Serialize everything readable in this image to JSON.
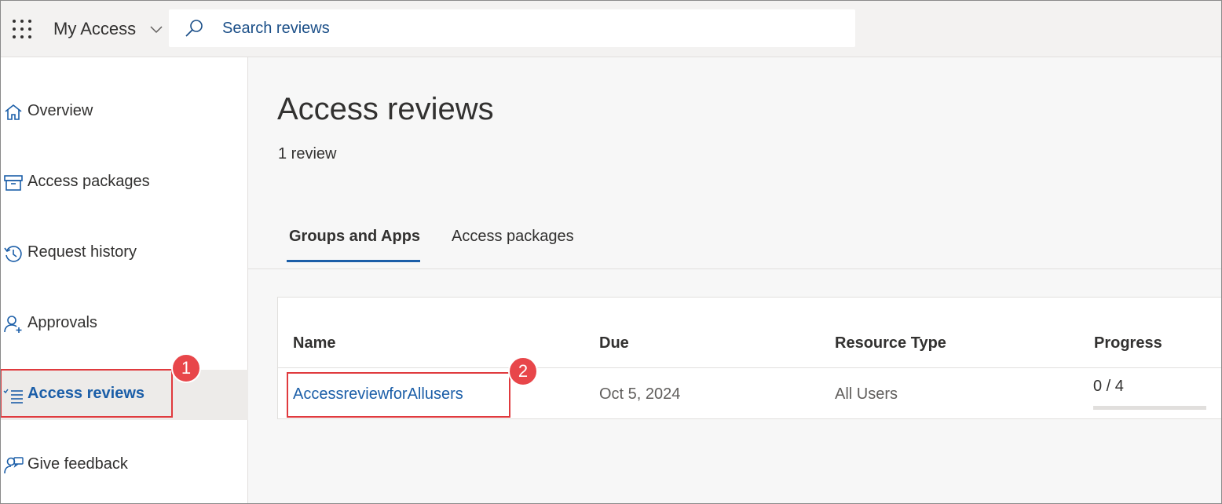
{
  "topbar": {
    "app_title": "My Access",
    "search_placeholder": "Search reviews"
  },
  "sidebar": {
    "items": [
      {
        "label": "Overview",
        "icon": "home-icon"
      },
      {
        "label": "Access packages",
        "icon": "package-icon"
      },
      {
        "label": "Request history",
        "icon": "history-icon"
      },
      {
        "label": "Approvals",
        "icon": "person-add-icon"
      },
      {
        "label": "Access reviews",
        "icon": "checklist-icon",
        "active": true
      },
      {
        "label": "Give feedback",
        "icon": "feedback-icon"
      }
    ]
  },
  "main": {
    "title": "Access reviews",
    "count": "1 review",
    "tabs": [
      {
        "label": "Groups and Apps",
        "active": true
      },
      {
        "label": "Access packages"
      }
    ],
    "table": {
      "headers": [
        "Name",
        "Due",
        "Resource Type",
        "Progress"
      ],
      "rows": [
        {
          "name": "AccessreviewforAllusers",
          "due": "Oct 5, 2024",
          "resource_type": "All Users",
          "progress": "0 / 4",
          "progress_fraction": 0
        }
      ]
    }
  },
  "callouts": [
    "1",
    "2"
  ],
  "colors": {
    "accent": "#1b5ea8",
    "callout": "#e8464a"
  }
}
